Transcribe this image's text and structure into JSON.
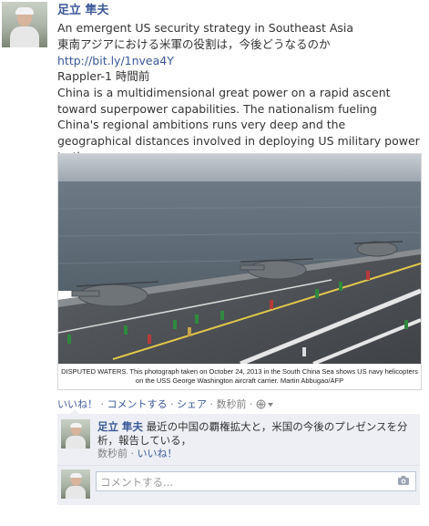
{
  "post": {
    "author": "足立 隼夫",
    "link_title_en": "An emergent US security strategy in Southeast Asia",
    "link_title_ja": "東南アジアにおける米軍の役割は，今後どうなるのか",
    "url": "http://bit.ly/1nvea4Y",
    "source_time": "Rappler-1 時間前",
    "excerpt": "China is a multidimensional great power on a rapid ascent toward superpower capabilities. The nationalism fueling China's regional ambitions runs very deep and the geographical distances involved in deploying US military power to the ...",
    "photo_caption": "DISPUTED WATERS. This photograph taken on October 24, 2013 in the South China Sea shows US navy helicopters on the USS George Washington aircraft carrier. Martin Abbugao/AFP",
    "actions": {
      "like": "いいね！",
      "comment": "コメントする",
      "share": "シェア",
      "time": "数秒前",
      "sep": " · "
    },
    "globe_icon": "globe-icon",
    "dropdown_icon": "chevron-down-icon"
  },
  "comment": {
    "author": "足立 隼夫",
    "text": "最近の中国の覇権拡大と，米国の今後のプレゼンスを分析，報告している，",
    "time": "数秒前",
    "like": "いいね！",
    "sep": " · "
  },
  "comment_input": {
    "placeholder": "コメントする...",
    "camera_icon": "camera-icon"
  },
  "colors": {
    "link": "#3b5998",
    "meta": "#808080",
    "comment_bg": "#edeff4",
    "deck_line": "#e2c84a"
  }
}
